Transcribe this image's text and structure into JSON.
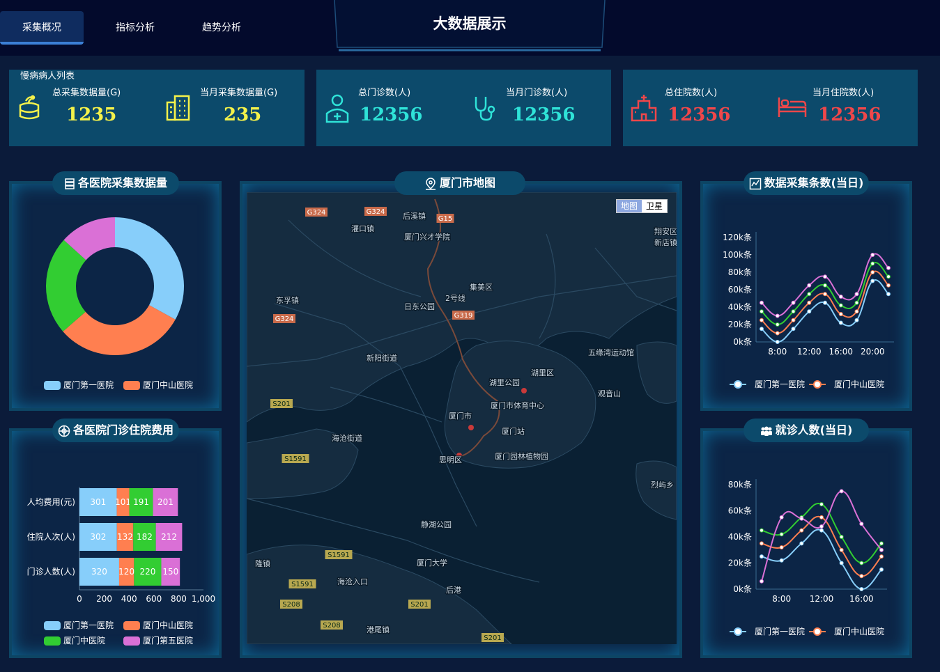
{
  "nav": {
    "tabs": [
      "采集概况",
      "指标分析",
      "趋势分析"
    ],
    "active": 0,
    "title": "大数据展示"
  },
  "stat_cards": [
    {
      "title": "慢病病人列表",
      "color": "#f5f24a",
      "items": [
        {
          "label": "总采集数据量(G)",
          "value": "1235",
          "icon": "database-icon"
        },
        {
          "label": "当月采集数据量(G)",
          "value": "235",
          "icon": "building-icon"
        }
      ]
    },
    {
      "title": "",
      "color": "#2fe3d8",
      "items": [
        {
          "label": "总门诊数(人)",
          "value": "12356",
          "icon": "patient-icon"
        },
        {
          "label": "当月门诊数(人)",
          "value": "12356",
          "icon": "stethoscope-icon"
        }
      ]
    },
    {
      "title": "",
      "color": "#f0474a",
      "items": [
        {
          "label": "总住院数(人)",
          "value": "12356",
          "icon": "hospital-icon"
        },
        {
          "label": "当月住院数(人)",
          "value": "12356",
          "icon": "bed-icon"
        }
      ]
    }
  ],
  "panels": {
    "donut": {
      "title": "各医院采集数据量"
    },
    "bar": {
      "title": "各医院门诊住院费用"
    },
    "map": {
      "title": "厦门市地图"
    },
    "collect": {
      "title": "数据采集条数(当日)"
    },
    "visits": {
      "title": "就诊人数(当日)"
    }
  },
  "map": {
    "toggle": [
      "地图",
      "卫星"
    ],
    "road_labels": [
      "G324",
      "G324",
      "G324",
      "G319",
      "G15",
      "S201",
      "S1591",
      "S1591",
      "S1591",
      "S208",
      "S208",
      "S201",
      "S201"
    ],
    "place_labels": [
      "后溪镇",
      "灌口镇",
      "厦门兴才学院",
      "集美区",
      "东孚镇",
      "日东公园",
      "翔安区",
      "新店镇",
      "2号线",
      "新阳街道",
      "五缘湾运动馆",
      "湖里区",
      "湖里公园",
      "观音山",
      "厦门市体育中心",
      "厦门市",
      "厦门站",
      "海沧街道",
      "思明区",
      "厦门园林植物园",
      "烈屿乡",
      "静湖公园",
      "厦门大学",
      "海沧入口",
      "后港",
      "港尾镇",
      "隆镇"
    ]
  },
  "chart_data": [
    {
      "type": "pie",
      "title": "各医院采集数据量",
      "series": [
        {
          "name": "厦门第一医院",
          "value": 335
        },
        {
          "name": "厦门中山医院",
          "value": 310
        },
        {
          "name": "厦门中医院",
          "value": 234
        },
        {
          "name": "厦门第五医院",
          "value": 135
        }
      ],
      "colors": [
        "#87cefa",
        "#ff7f50",
        "#32cd32",
        "#da70d6"
      ],
      "legend_visible": [
        "厦门第一医院",
        "厦门中山医院"
      ],
      "legend": "bottom"
    },
    {
      "type": "bar",
      "orientation": "horizontal-stacked",
      "title": "各医院门诊住院费用",
      "categories": [
        "门诊人数(人)",
        "住院人次(人)",
        "人均费用(元)"
      ],
      "series": [
        {
          "name": "厦门第一医院",
          "values": [
            320,
            302,
            301
          ]
        },
        {
          "name": "厦门中山医院",
          "values": [
            120,
            132,
            101
          ]
        },
        {
          "name": "厦门中医院",
          "values": [
            220,
            182,
            191
          ]
        },
        {
          "name": "厦门第五医院",
          "values": [
            150,
            212,
            201
          ]
        }
      ],
      "data_labels": [
        [
          "320",
          "120",
          "220",
          "150"
        ],
        [
          "302",
          "132",
          "182",
          "212"
        ],
        [
          "301",
          "101",
          "191",
          "201"
        ]
      ],
      "colors": [
        "#87cefa",
        "#ff7f50",
        "#32cd32",
        "#da70d6"
      ],
      "xticks": [
        "0",
        "200",
        "400",
        "600",
        "800",
        "1,000"
      ],
      "xlim": [
        0,
        1000
      ],
      "legend": "bottom"
    },
    {
      "type": "line",
      "title": "数据采集条数(当日)",
      "x": [
        6,
        8,
        10,
        12,
        14,
        16,
        18,
        20,
        22
      ],
      "xticks": [
        "8:00",
        "12:00",
        "16:00",
        "20:00"
      ],
      "yticks": [
        "0k条",
        "20k条",
        "40k条",
        "60k条",
        "80k条",
        "100k条",
        "120k条"
      ],
      "ylim": [
        0,
        120000
      ],
      "series": [
        {
          "name": "厦门第一医院",
          "values": [
            15000,
            0,
            15000,
            35000,
            45000,
            22000,
            25000,
            70000,
            55000
          ]
        },
        {
          "name": "厦门中山医院",
          "values": [
            25000,
            10000,
            25000,
            45000,
            55000,
            32000,
            35000,
            80000,
            65000
          ]
        },
        {
          "name": "厦门中医院",
          "values": [
            35000,
            20000,
            35000,
            55000,
            65000,
            42000,
            45000,
            90000,
            75000
          ]
        },
        {
          "name": "厦门第五医院",
          "values": [
            45000,
            30000,
            45000,
            65000,
            75000,
            52000,
            55000,
            100000,
            85000
          ]
        }
      ],
      "colors": [
        "#87cefa",
        "#ff7f50",
        "#32cd32",
        "#da70d6"
      ],
      "legend_visible": [
        "厦门第一医院",
        "厦门中山医院"
      ],
      "legend": "bottom"
    },
    {
      "type": "line",
      "title": "就诊人数(当日)",
      "x": [
        6,
        8,
        10,
        12,
        14,
        16,
        18
      ],
      "xticks": [
        "8:00",
        "12:00",
        "16:00"
      ],
      "yticks": [
        "0k条",
        "20k条",
        "40k条",
        "60k条",
        "80k条"
      ],
      "ylim": [
        0,
        80000
      ],
      "series": [
        {
          "name": "厦门第一医院",
          "values": [
            25000,
            22000,
            35000,
            45000,
            20000,
            0,
            15000
          ]
        },
        {
          "name": "厦门中山医院",
          "values": [
            35000,
            32000,
            45000,
            55000,
            30000,
            10000,
            25000
          ]
        },
        {
          "name": "厦门中医院",
          "values": [
            45000,
            42000,
            55000,
            65000,
            40000,
            20000,
            35000
          ]
        },
        {
          "name": "厦门第五医院",
          "values": [
            6000,
            55000,
            54000,
            48000,
            75000,
            50000,
            30000
          ]
        }
      ],
      "colors": [
        "#87cefa",
        "#ff7f50",
        "#32cd32",
        "#da70d6"
      ],
      "legend_visible": [
        "厦门第一医院",
        "厦门中山医院"
      ],
      "legend": "bottom"
    }
  ]
}
